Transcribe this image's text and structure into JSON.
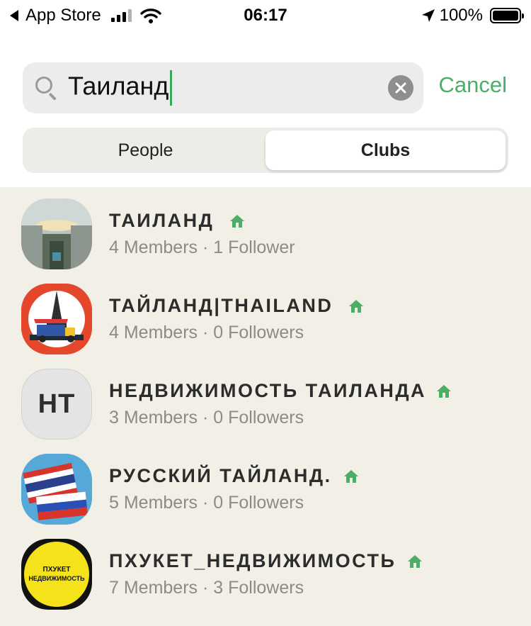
{
  "status_bar": {
    "back_app": "App Store",
    "time": "06:17",
    "battery": "100%"
  },
  "search": {
    "value": "Таиланд",
    "cancel_label": "Cancel"
  },
  "tabs": {
    "people": "People",
    "clubs": "Clubs",
    "active": "clubs"
  },
  "clubs": [
    {
      "name": "ТАИЛАНД",
      "meta": "4 Members · 1 Follower",
      "avatar": "photo-city"
    },
    {
      "name": "ТАЙЛАНД|THAILAND",
      "meta": "4 Members · 0 Followers",
      "avatar": "temple-tuktuk"
    },
    {
      "name": "НЕДВИЖИМОСТЬ ТАИЛАНДА",
      "meta": "3 Members · 0 Followers",
      "avatar_initials": "НТ"
    },
    {
      "name": "РУССКИЙ ТАЙЛАНД.",
      "meta": "5 Members · 0 Followers",
      "avatar": "flags-thai-russia"
    },
    {
      "name": "ПХУКЕТ_НЕДВИЖИМОСТЬ",
      "meta": "7 Members · 3 Followers",
      "avatar_text_line1": "ПХУКЕТ",
      "avatar_text_line2": "НЕДВИЖИМОСТЬ"
    }
  ],
  "colors": {
    "accent_green": "#4cae65",
    "results_bg": "#f1efe6",
    "search_bg": "#ececec"
  }
}
